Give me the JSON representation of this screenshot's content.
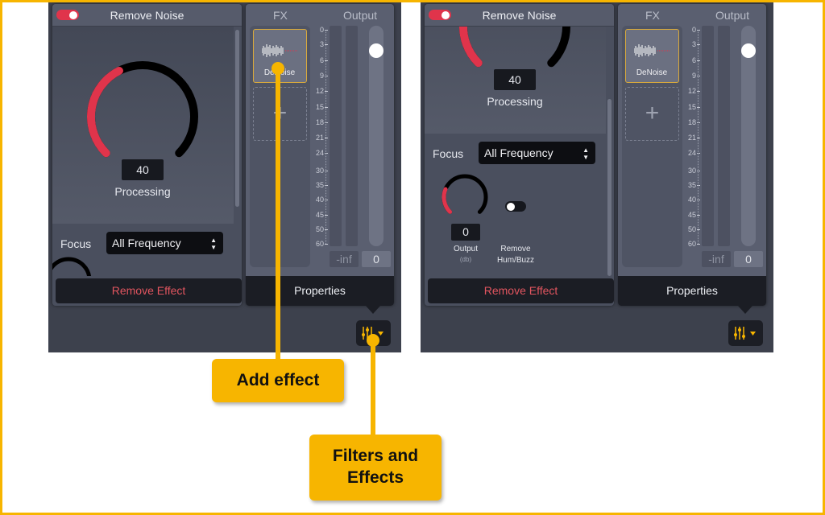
{
  "screens": [
    {
      "effect": {
        "toggle_on": true,
        "title": "Remove Noise",
        "processing_value": "40",
        "processing_label": "Processing",
        "processing_level": 0.4,
        "focus_label": "Focus",
        "focus_value": "All Frequency",
        "remove_effect": "Remove Effect"
      },
      "fx": {
        "fx_label": "FX",
        "output_label": "Output",
        "tile_label": "DeNoise",
        "add_icon": "plus-icon",
        "scale": [
          "0",
          "3",
          "6",
          "9",
          "12",
          "15",
          "18",
          "21",
          "24",
          "30",
          "35",
          "40",
          "45",
          "50",
          "60"
        ],
        "peak": "-inf",
        "gain": "0",
        "properties": "Properties"
      }
    },
    {
      "effect": {
        "toggle_on": true,
        "title": "Remove Noise",
        "processing_value": "40",
        "processing_label": "Processing",
        "processing_level": 0.4,
        "focus_label": "Focus",
        "focus_value": "All Frequency",
        "output_value": "0",
        "output_label": "Output",
        "output_unit": "(db)",
        "hum_label_1": "Remove",
        "hum_label_2": "Hum/Buzz",
        "hum_on": false,
        "remove_effect": "Remove Effect"
      },
      "fx": {
        "fx_label": "FX",
        "output_label": "Output",
        "tile_label": "DeNoise",
        "add_icon": "plus-icon",
        "scale": [
          "0",
          "3",
          "6",
          "9",
          "12",
          "15",
          "18",
          "21",
          "24",
          "30",
          "35",
          "40",
          "45",
          "50",
          "60"
        ],
        "peak": "-inf",
        "gain": "0",
        "properties": "Properties"
      }
    }
  ],
  "callouts": {
    "add_effect": "Add effect",
    "filters_1": "Filters and",
    "filters_2": "Effects"
  },
  "colors": {
    "accent": "#f7b500",
    "knob_red": "#e0344b",
    "panel": "#3d414d"
  }
}
